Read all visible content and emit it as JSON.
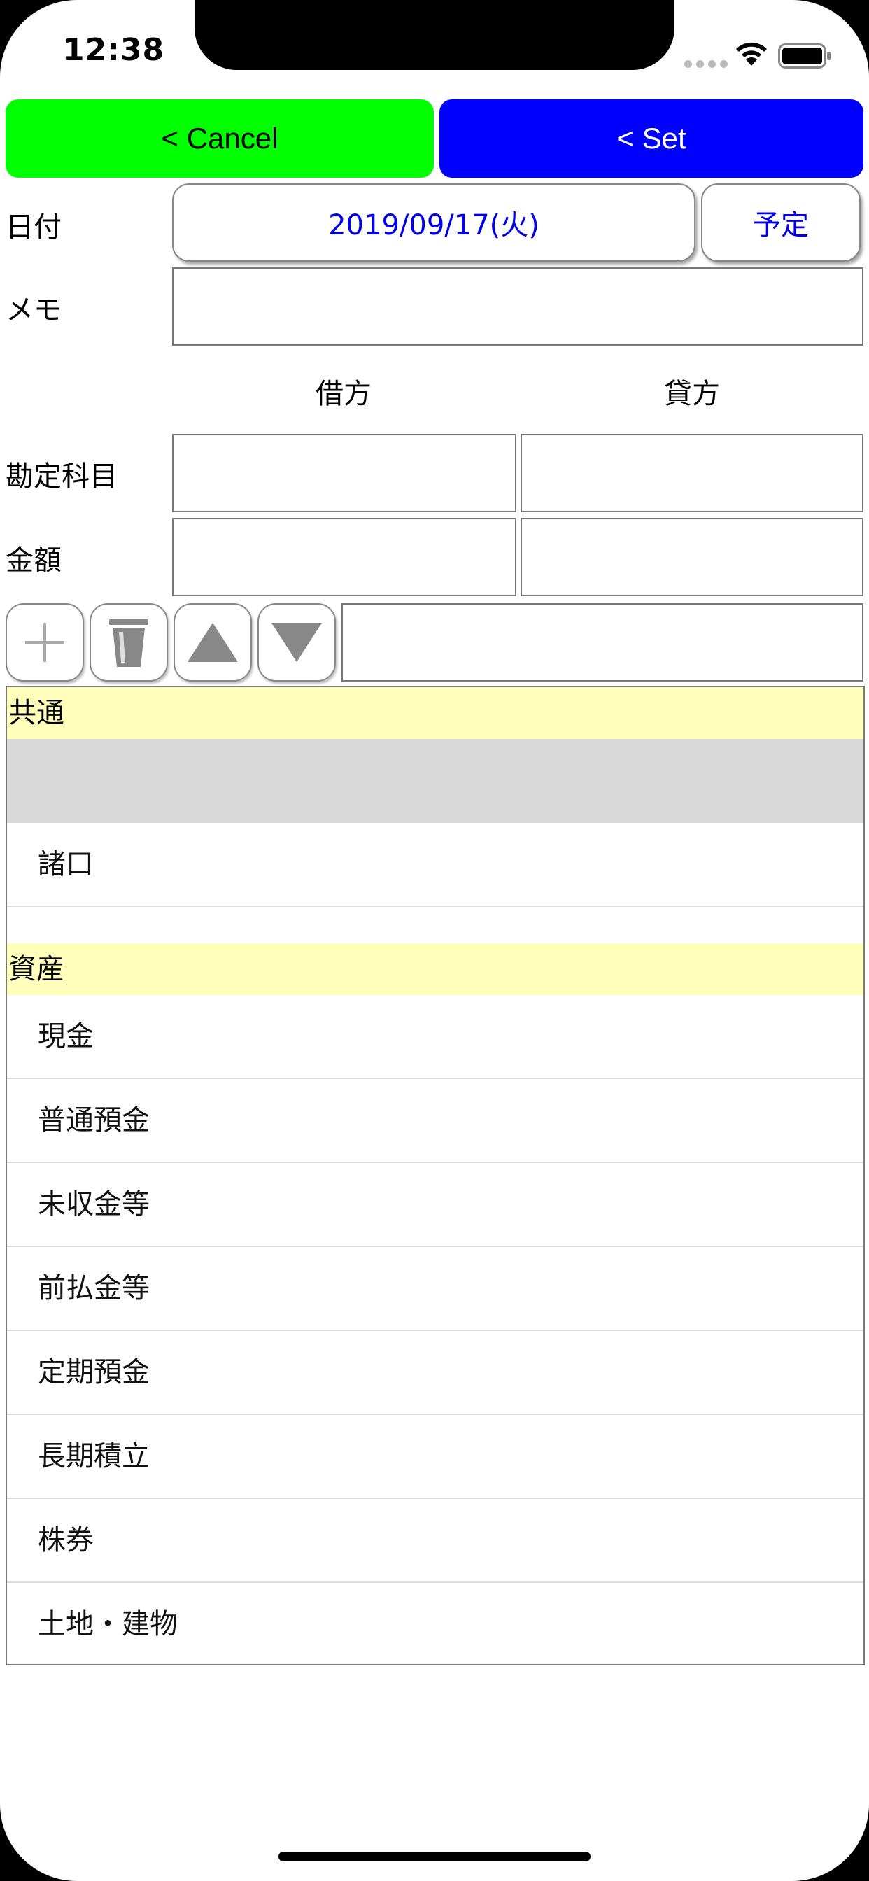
{
  "status_bar": {
    "time": "12:38"
  },
  "top_buttons": {
    "cancel_label": "< Cancel",
    "set_label": "< Set",
    "cancel_color": "#00ff00",
    "set_color": "#0000ff"
  },
  "form": {
    "date_label": "日付",
    "date_value": "2019/09/17(火)",
    "schedule_button": "予定",
    "memo_label": "メモ",
    "memo_value": "",
    "debit_header": "借方",
    "credit_header": "貸方",
    "account_label": "勘定科目",
    "amount_label": "金額",
    "debit_account": "",
    "credit_account": "",
    "debit_amount": "",
    "credit_amount": ""
  },
  "toolbar": {
    "add_icon": "plus-icon",
    "delete_icon": "trash-icon",
    "up_icon": "triangle-up-icon",
    "down_icon": "triangle-down-icon",
    "search_value": ""
  },
  "list": {
    "sections": [
      {
        "title": "共通",
        "items": [
          "",
          "諸口"
        ]
      },
      {
        "title": "資産",
        "items": [
          "現金",
          "普通預金",
          "未収金等",
          "前払金等",
          "定期預金",
          "長期積立",
          "株券",
          "土地・建物"
        ]
      }
    ],
    "header_color": "#ffffbb",
    "selected_color": "#d9d9d9"
  }
}
